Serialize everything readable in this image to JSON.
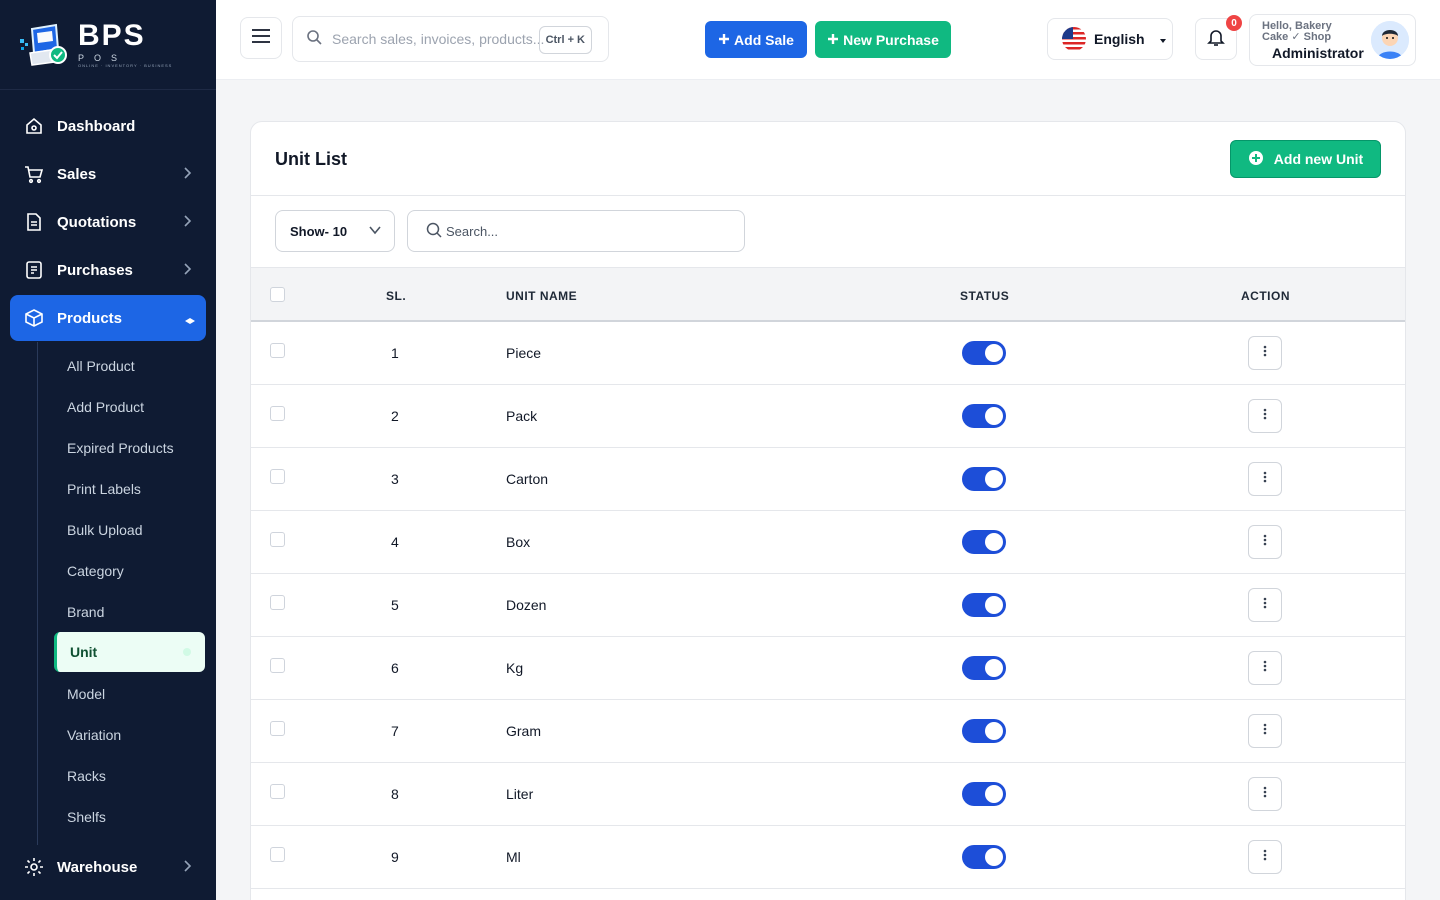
{
  "brand": {
    "name": "BPS",
    "sub": "POS",
    "tagline": "ONLINE · INVENTORY · BUSINESS"
  },
  "sidebar": {
    "items": [
      {
        "label": "Dashboard",
        "icon": "home-icon",
        "chevron": false
      },
      {
        "label": "Sales",
        "icon": "cart-icon",
        "chevron": true
      },
      {
        "label": "Quotations",
        "icon": "document-icon",
        "chevron": true
      },
      {
        "label": "Purchases",
        "icon": "receipt-icon",
        "chevron": true
      },
      {
        "label": "Products",
        "icon": "box-icon",
        "active": true
      }
    ],
    "product_subitems": [
      "All Product",
      "Add Product",
      "Expired Products",
      "Print Labels",
      "Bulk Upload",
      "Category",
      "Brand",
      "Unit",
      "Model",
      "Variation",
      "Racks",
      "Shelfs"
    ],
    "active_subitem": "Unit",
    "warehouse_label": "Warehouse"
  },
  "header": {
    "search_placeholder": "Search sales, invoices, products...",
    "shortcut": "Ctrl + K",
    "add_sale": "Add Sale",
    "new_purchase": "New Purchase",
    "language": "English",
    "notification_count": "0",
    "greeting": "Hello, Bakery Cake ✓ Shop",
    "role": "Administrator"
  },
  "colors": {
    "primary": "#1d66e5",
    "success": "#10b981",
    "sidebar": "#0f1b33"
  },
  "page": {
    "title": "Unit List",
    "add_button": "Add new Unit",
    "show_select": "Show- 10",
    "search_placeholder": "Search...",
    "columns": {
      "sl": "SL.",
      "name": "UNIT NAME",
      "status": "STATUS",
      "action": "ACTION"
    },
    "rows": [
      {
        "sl": "1",
        "name": "Piece",
        "status": true
      },
      {
        "sl": "2",
        "name": "Pack",
        "status": true
      },
      {
        "sl": "3",
        "name": "Carton",
        "status": true
      },
      {
        "sl": "4",
        "name": "Box",
        "status": true
      },
      {
        "sl": "5",
        "name": "Dozen",
        "status": true
      },
      {
        "sl": "6",
        "name": "Kg",
        "status": true
      },
      {
        "sl": "7",
        "name": "Gram",
        "status": true
      },
      {
        "sl": "8",
        "name": "Liter",
        "status": true
      },
      {
        "sl": "9",
        "name": "Ml",
        "status": true
      }
    ]
  }
}
